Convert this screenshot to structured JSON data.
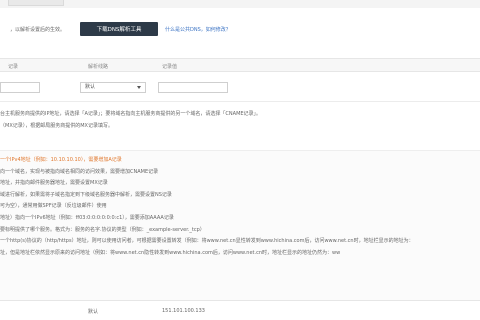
{
  "header": {
    "notice_text": "，以解析设置后的生效。",
    "download_button": "下载DNS解析工具",
    "help_link": "什么是公共DNS，如何修改？"
  },
  "table": {
    "columns": [
      "记录",
      "解析线路",
      "记录值"
    ],
    "input_row": {
      "record_value": "",
      "line_selected": "默认",
      "value_field": ""
    }
  },
  "description": [
    "台主机服务商提供的IP地址，请选择「A记录」；要将域名指向主机服务商提供的另一个域名，请选择「CNAME记录」。",
    "（MX记录），根据邮局服务商提供的MX记录填写。"
  ],
  "help_lines": [
    "一个IPv4地址（例如：10.10.10.10），需要增加A记录",
    "向一个域名，实现与被指向域名相同的访问效果，需要增加CNAME记录",
    "地址，并指向邮件服务器地址，需要设置MX记录",
    "域进行解析，如果需将子域名指定到下级域名服务器中解析，需要设置NS记录",
    "可为空），通常用做SPF记录（反垃圾邮件）使用",
    "地址）指向一个IPv6地址（例如：ff03:0:0:0:0:0:0:c1），需要添加AAAA记录",
    "要标明提供了哪个服务。格式为：服务的名字.协议的类型（例如：_example-server._tcp）",
    "一个http(s)协议的（http/https）地址，则可以使用访问者，可根据需要设置转发（例如：将www.net.cn显性转发到www.hichina.com后，访问www.net.cn时，地址栏显示的地址为：",
    "址，但是地址栏依然显示原来的访问地址（例如：将www.net.cn隐性转发到www.hichina.com后，访问www.net.cn时，地址栏显示的地址仍然为：ww"
  ],
  "bottom_row": {
    "line": "默认",
    "value": "151.101.100.133"
  }
}
